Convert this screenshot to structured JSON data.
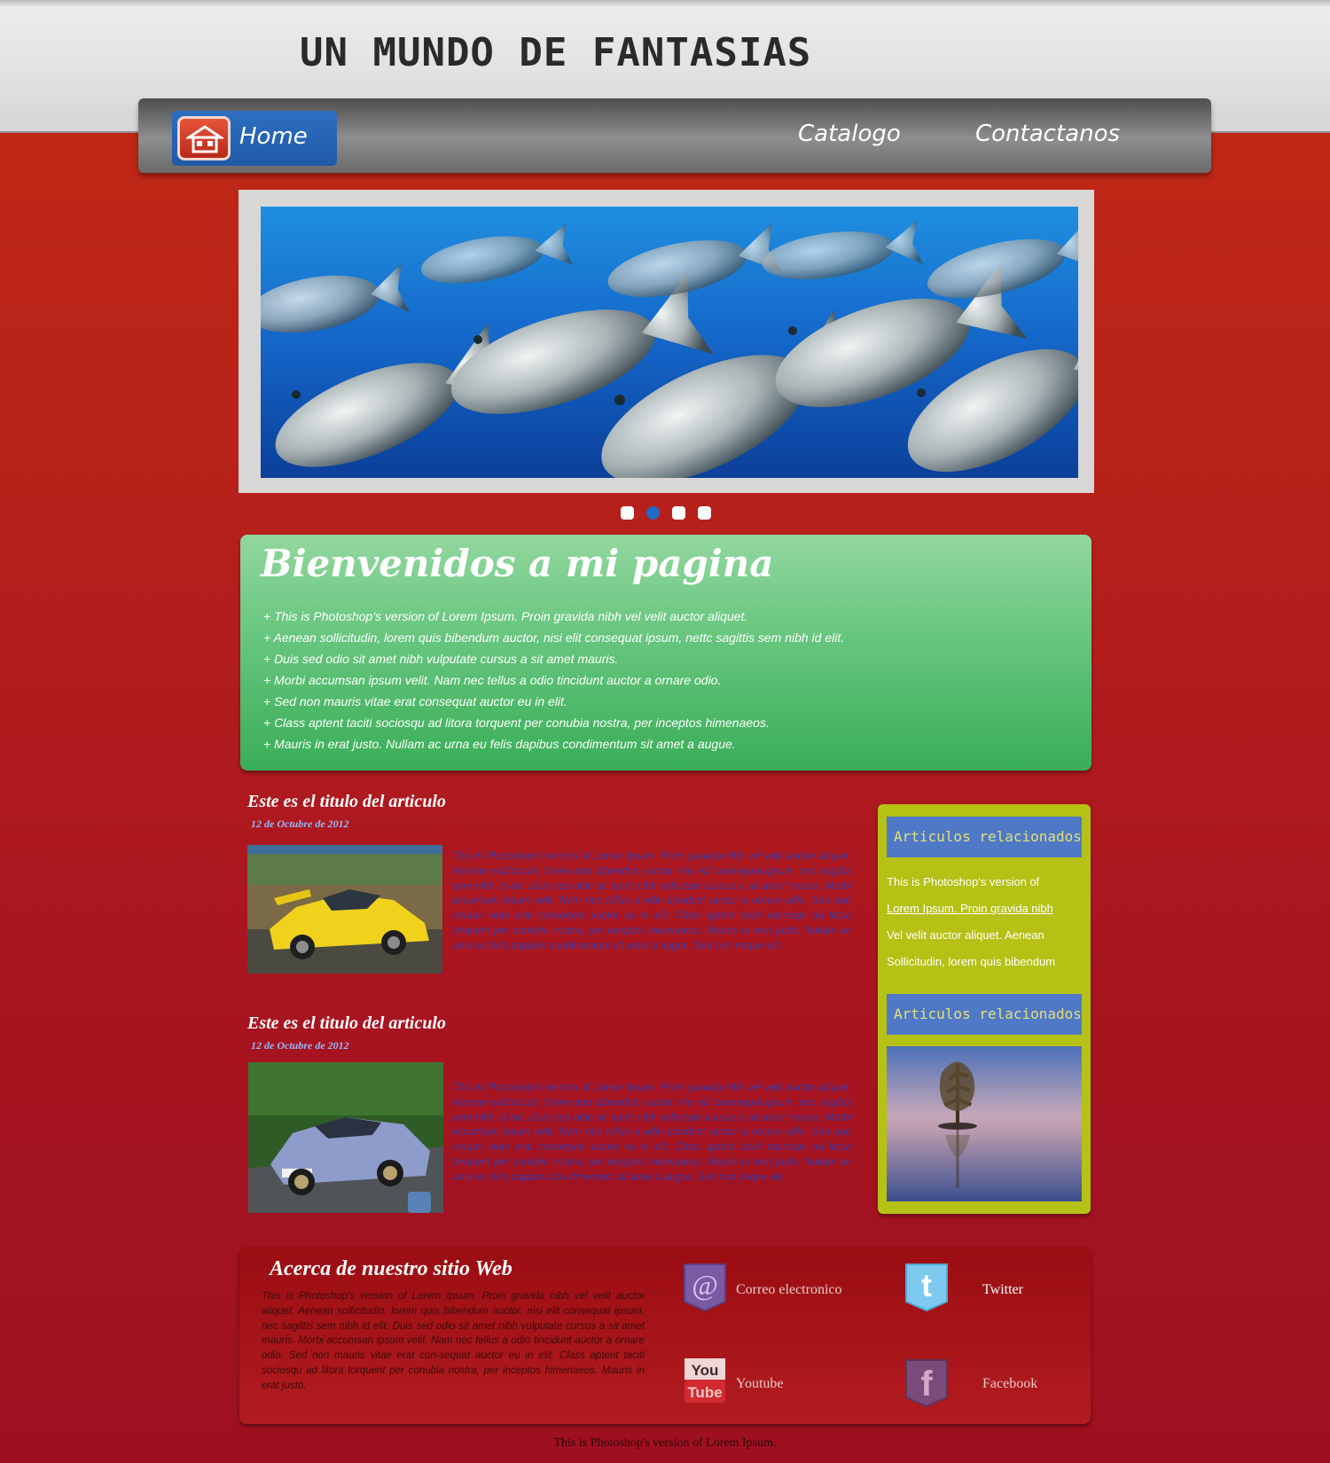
{
  "header": {
    "site_title": "UN MUNDO DE FANTASIAS"
  },
  "nav": {
    "items": [
      {
        "label": "Home",
        "icon": "home-icon",
        "active": true
      },
      {
        "label": "Catalogo"
      },
      {
        "label": "Contactanos"
      }
    ]
  },
  "slider": {
    "slide_count": 4,
    "active_index": 1
  },
  "welcome": {
    "title": "Bienvenidos a mi pagina",
    "bullets": [
      "+ This is Photoshop's version  of Lorem Ipsum. Proin gravida nibh vel velit auctor aliquet.",
      "+ Aenean sollicitudin, lorem quis bibendum auctor, nisi elit consequat ipsum, nettc sagittis sem nibh id elit.",
      "+ Duis sed odio sit amet nibh vulputate cursus a sit amet mauris.",
      "+ Morbi accumsan ipsum velit. Nam nec tellus a odio tincidunt auctor a ornare odio.",
      "+ Sed non  mauris vitae erat consequat auctor eu in elit.",
      "+ Class aptent taciti sociosqu ad litora torquent per conubia nostra, per inceptos himenaeos.",
      "+ Mauris in erat justo. Nullam ac urna eu felis dapibus condimentum sit amet a augue."
    ]
  },
  "articles": [
    {
      "title": "Este es el titulo del articulo",
      "date": "12 de Octubre de 2012",
      "text": "This is Photoshop's version  of Lorem Ipsum. Proin gravida nibh vel velit auctor aliquet. Aenean sollicitudin, lorem quis bibendum auctor, nisi elit consequat ipsum, nec sagittis sem nibh id elit. Duis sed odio sit amet nibh vulputate cursus a sit amet mauris. Morbi accumsan ipsum velit. Nam nec tellus a odio tincidunt auctor a ornare odio. Sed non  mauris vitae erat consequat auctor eu in elit. Class aptent taciti sociosqu ad litora torquent per conubia nostra, per inceptos himenaeos. Mauris in erat justo. Nullam ac urna eu felis dapibus condimentum sit amet a augue. Sed non neque elit."
    },
    {
      "title": "Este es el titulo del articulo",
      "date": "12 de Octubre de 2012",
      "text": "This is Photoshop's version  of Lorem Ipsum. Proin gravida nibh vel velit auctor aliquet. Aenean sollicitudin, lorem quis bibendum auctor, nisi elit consequat ipsum, nec sagittis sem nibh id elit. Duis sed odio sit amet nibh vulputate cursus a sit amet mauris. Morbi accumsan ipsum velit. Nam nec tellus a odio tincidunt auctor a ornare odio. Sed non  mauris vitae erat consequat auctor eu in elit. Class aptent taciti sociosqu ad litora torquent per conubia nostra, per inceptos himenaeos. Mauris in erat justo. Nullam ac urna eu felis dapibus con-dimentum sit amet a augue. Sed non neque elit."
    }
  ],
  "sidebar": {
    "heading_1": "Articulos relacionados",
    "lines": [
      "This is Photoshop's version  of",
      "Lorem Ipsum. Proin gravida nibh",
      "Vel velit auctor aliquet. Aenean",
      "Sollicitudin, lorem quis bibendum"
    ],
    "heading_2": "Articulos relacionados"
  },
  "footer": {
    "about_title": "Acerca de nuestro sitio Web",
    "about_text": "This is Photoshop's version  of Lorem Ipsum. Proin gravida nibh vel velit auctor aliquet. Aenean sollicitudin, lorem quis bibendum auctor, nisi elit consequat ipsum, nec sagittis sem nibh id elit. Duis sed odio sit amet nibh vulputate cursus a sit amet mauris. Morbi accumsan ipsum velit. Nam nec tellus a odio tincidunt auctor a ornare odio. Sed non  mauris vitae erat con-sequat auctor eu in elit. Class aptent taciti sociosqu ad litora torquent per conubia nostra, per inceptos himenaeos. Mauris in erat justo.",
    "social": [
      {
        "label": "Correo electronico",
        "icon": "email-icon"
      },
      {
        "label": "Twitter",
        "icon": "twitter-icon"
      },
      {
        "label": "Youtube",
        "icon": "youtube-icon"
      },
      {
        "label": "Facebook",
        "icon": "facebook-icon"
      }
    ],
    "bottom_note": "This is Photoshop's version  of Lorem Ipsum."
  },
  "colors": {
    "nav_active": "#2563b8",
    "welcome_green": "#39ae58",
    "sidebar_bg": "#b5c115",
    "sidebar_heading": "#4f78c6",
    "date_blue": "#93b9ff"
  }
}
